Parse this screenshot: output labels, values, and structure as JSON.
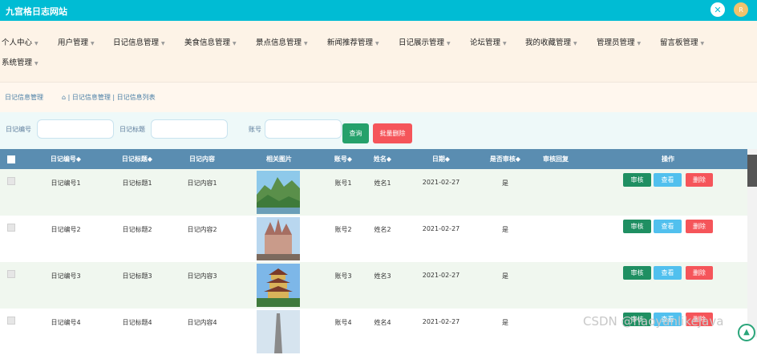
{
  "header": {
    "title": "九宫格日志网站",
    "avatar_text": "R"
  },
  "nav": [
    "个人中心",
    "用户管理",
    "日记信息管理",
    "美食信息管理",
    "景点信息管理",
    "新闻推荐管理",
    "日记展示管理",
    "论坛管理",
    "我的收藏管理",
    "管理员管理",
    "留言板管理",
    "系统管理"
  ],
  "breadcrumb": {
    "title": "日记信息管理",
    "path": "| 日记信息管理 | 日记信息列表"
  },
  "search": {
    "label_diary_no": "日记编号",
    "label_diary_title": "日记标题",
    "label_account": "账号",
    "search_button": "查询",
    "batch_delete_button": "批量删除"
  },
  "table": {
    "columns": [
      "日记编号◆",
      "日记标题◆",
      "日记内容",
      "相关图片",
      "账号◆",
      "姓名◆",
      "日期◆",
      "是否审核◆",
      "审核回复",
      "操作"
    ],
    "rows": [
      {
        "no": "日记编号1",
        "title": "日记标题1",
        "content": "日记内容1",
        "account": "账号1",
        "name": "姓名1",
        "date": "2021-02-27",
        "approved": "是"
      },
      {
        "no": "日记编号2",
        "title": "日记标题2",
        "content": "日记内容2",
        "account": "账号2",
        "name": "姓名2",
        "date": "2021-02-27",
        "approved": "是"
      },
      {
        "no": "日记编号3",
        "title": "日记标题3",
        "content": "日记内容3",
        "account": "账号3",
        "name": "姓名3",
        "date": "2021-02-27",
        "approved": "是"
      },
      {
        "no": "日记编号4",
        "title": "日记标题4",
        "content": "日记内容4",
        "account": "账号4",
        "name": "姓名4",
        "date": "2021-02-27",
        "approved": "是"
      }
    ],
    "actions": {
      "audit": "审核",
      "view": "查看",
      "delete": "删除"
    }
  },
  "watermark": "CSDN @haoyanlikeJava",
  "colors": {
    "header": "#00bcd4",
    "table_head": "#5a8db1",
    "audit": "#1f8f62",
    "view": "#51c0ee",
    "delete": "#f5555a"
  }
}
